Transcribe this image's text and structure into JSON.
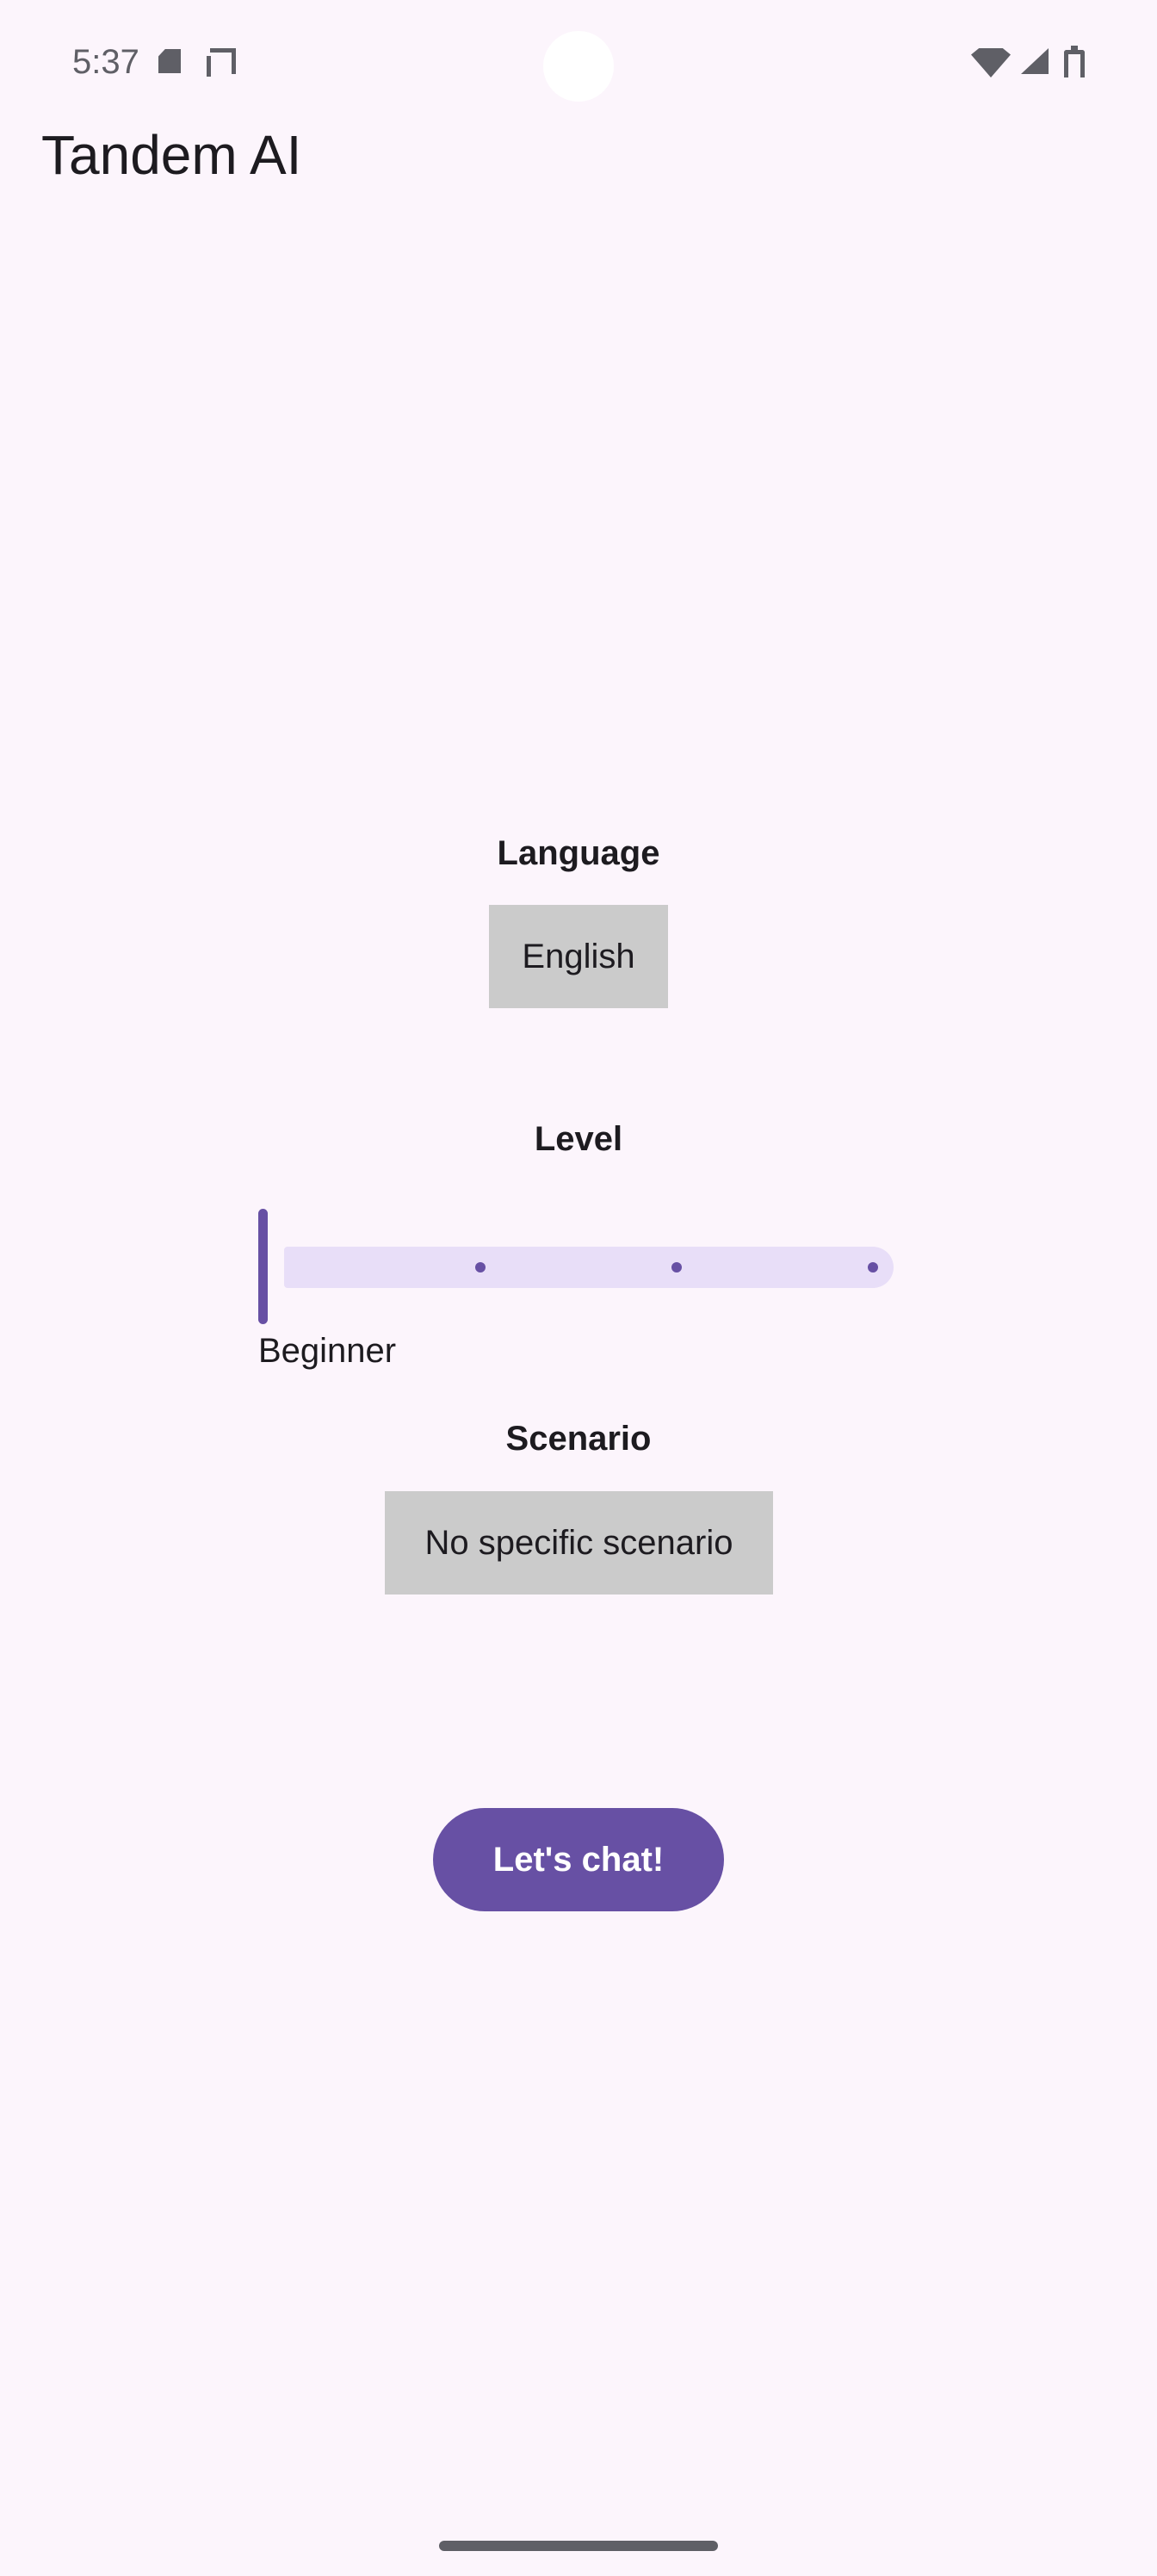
{
  "status_bar": {
    "time": "5:37",
    "icons": [
      "sd-card-icon",
      "cast-icon",
      "wifi-icon",
      "cellular-signal-icon",
      "battery-icon"
    ]
  },
  "app_bar": {
    "title": "Tandem AI"
  },
  "language": {
    "label": "Language",
    "selected": "English"
  },
  "level": {
    "label": "Level",
    "value_label": "Beginner",
    "slider_position": 0,
    "steps": 4
  },
  "scenario": {
    "label": "Scenario",
    "selected": "No specific scenario"
  },
  "actions": {
    "start_label": "Let's chat!"
  },
  "colors": {
    "background": "#fcf5fc",
    "primary": "#6750a4",
    "track": "#e8def8",
    "select_box": "#cbcbcb",
    "text": "#1d1b20"
  }
}
